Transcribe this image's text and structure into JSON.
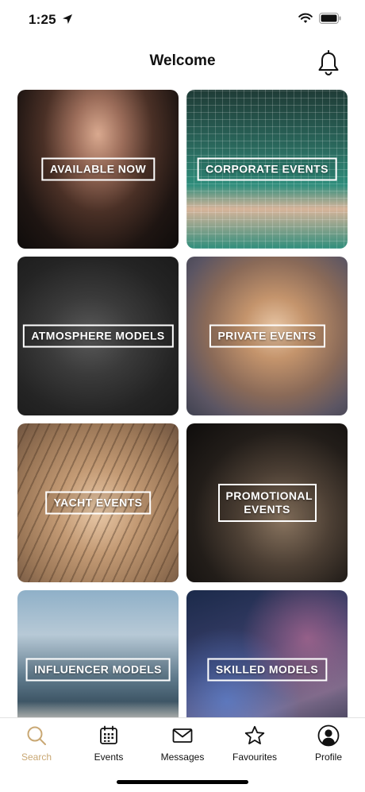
{
  "status_bar": {
    "time": "1:25"
  },
  "header": {
    "title": "Welcome"
  },
  "cards": [
    {
      "label": "AVAILABLE NOW"
    },
    {
      "label": "CORPORATE EVENTS"
    },
    {
      "label": "ATMOSPHERE MODELS"
    },
    {
      "label": "PRIVATE EVENTS"
    },
    {
      "label": "YACHT EVENTS"
    },
    {
      "label": "PROMOTIONAL EVENTS"
    },
    {
      "label": "INFLUENCER MODELS"
    },
    {
      "label": "SKILLED MODELS"
    }
  ],
  "tabs": [
    {
      "label": "Search",
      "icon": "search-icon",
      "active": true
    },
    {
      "label": "Events",
      "icon": "calendar-icon"
    },
    {
      "label": "Messages",
      "icon": "envelope-icon"
    },
    {
      "label": "Favourites",
      "icon": "star-icon"
    },
    {
      "label": "Profile",
      "icon": "profile-icon"
    }
  ],
  "colors": {
    "accent": "#c9a874"
  }
}
